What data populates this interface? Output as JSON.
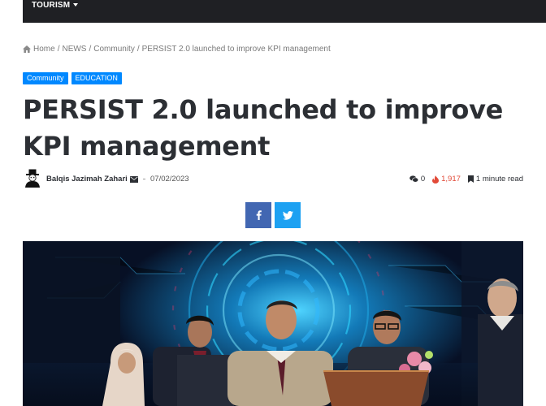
{
  "nav": {
    "item_label": "TOURISM"
  },
  "breadcrumb": {
    "home": "Home",
    "news": "NEWS",
    "community": "Community",
    "current": "PERSIST 2.0 launched to improve KPI management",
    "separator": "/"
  },
  "categories": [
    "Community",
    "EDUCATION"
  ],
  "article": {
    "title": "PERSIST 2.0 launched to improve KPI management",
    "author": "Balqis Jazimah Zahari",
    "date": "07/02/2023",
    "comments": "0",
    "views": "1,917",
    "read_time": "1 minute read"
  },
  "icons": {
    "home": "home-icon",
    "mail": "envelope-icon",
    "comments": "comment-icon",
    "views": "fire-icon",
    "read_time": "bookmark-icon",
    "facebook": "facebook-icon",
    "twitter": "twitter-icon"
  },
  "colors": {
    "topbar": "#1f2024",
    "category_badge": "#0088ff",
    "views": "#e24a38",
    "facebook": "#4267b2",
    "twitter": "#1da1f2"
  }
}
